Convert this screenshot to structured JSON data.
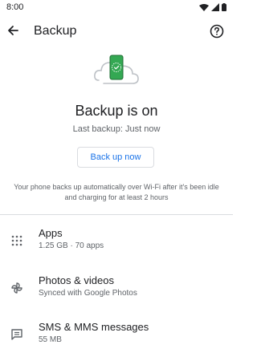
{
  "status_bar": {
    "time": "8:00"
  },
  "app_bar": {
    "title": "Backup"
  },
  "hero": {
    "headline": "Backup is on",
    "last_backup": "Last backup: Just now",
    "button_label": "Back up now",
    "description": "Your phone backs up automatically over Wi-Fi after it's been idle and charging for at least 2 hours"
  },
  "items": [
    {
      "title": "Apps",
      "subtitle": "1.25 GB · 70 apps",
      "icon": "apps-grid-icon"
    },
    {
      "title": "Photos & videos",
      "subtitle": "Synced with Google Photos",
      "icon": "pinwheel-icon"
    },
    {
      "title": "SMS & MMS messages",
      "subtitle": "55 MB",
      "icon": "message-icon"
    }
  ],
  "colors": {
    "accent": "#1a73e8",
    "phone_green": "#34a853",
    "text_primary": "#202124",
    "text_secondary": "#5f6368"
  }
}
